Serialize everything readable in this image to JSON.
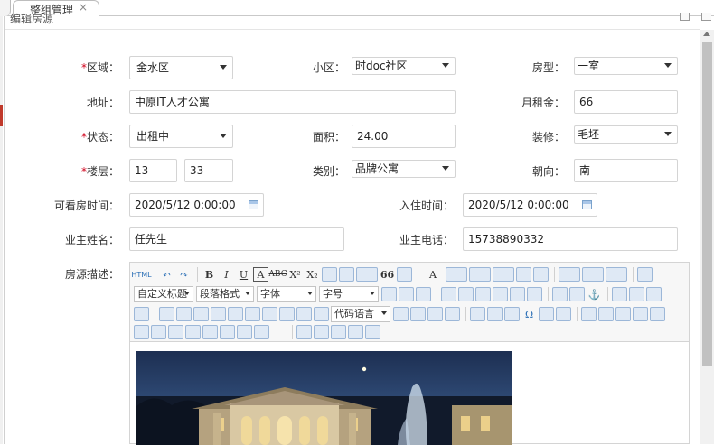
{
  "tabs": [
    {
      "label": "整组管理",
      "close": "×"
    }
  ],
  "dialog": {
    "title": "编辑房源"
  },
  "form": {
    "district": {
      "label": "区域：",
      "required": "*",
      "value": "金水区"
    },
    "community": {
      "label": "小区：",
      "value": "时doc社区"
    },
    "room_type": {
      "label": "房型：",
      "value": "一室"
    },
    "address": {
      "label": "地址：",
      "value": "中原IT人才公寓"
    },
    "monthly_rent": {
      "label": "月租金：",
      "value": "66"
    },
    "status": {
      "label": "状态：",
      "required": "*",
      "value": "出租中"
    },
    "area": {
      "label": "面积：",
      "value": "24.00"
    },
    "decoration": {
      "label": "装修：",
      "value": "毛坯"
    },
    "floor": {
      "label": "楼层：",
      "required": "*",
      "value": "13",
      "total": "33"
    },
    "category": {
      "label": "类别：",
      "value": "品牌公寓"
    },
    "orientation": {
      "label": "朝向：",
      "value": "南"
    },
    "viewing_time": {
      "label": "可看房时间：",
      "value": "2020/5/12 0:00:00"
    },
    "checkin_time": {
      "label": "入住时间：",
      "value": "2020/5/12 0:00:00"
    },
    "owner_name": {
      "label": "业主姓名：",
      "value": "任先生"
    },
    "owner_phone": {
      "label": "业主电话：",
      "value": "15738890332"
    },
    "description": {
      "label": "房源描述："
    }
  },
  "editor": {
    "combos": {
      "heading": "自定义标题",
      "paragraph": "段落格式",
      "font_family": "字体",
      "font_size": "字号",
      "code_lang": "代码语言"
    },
    "glyphs": {
      "html": "HTML",
      "undo": "↶",
      "redo": "↷",
      "bold": "B",
      "italic": "I",
      "underline": "U",
      "border_a": "A",
      "strike": "ABC",
      "sup": "X²",
      "sub": "X₂",
      "quote": "66",
      "font_color": "A",
      "link": "⚓",
      "omega": "Ω"
    }
  },
  "colors": {
    "required": "#d0021b",
    "border": "#d4d4d4",
    "icon_blue": "#2b6fb6"
  }
}
